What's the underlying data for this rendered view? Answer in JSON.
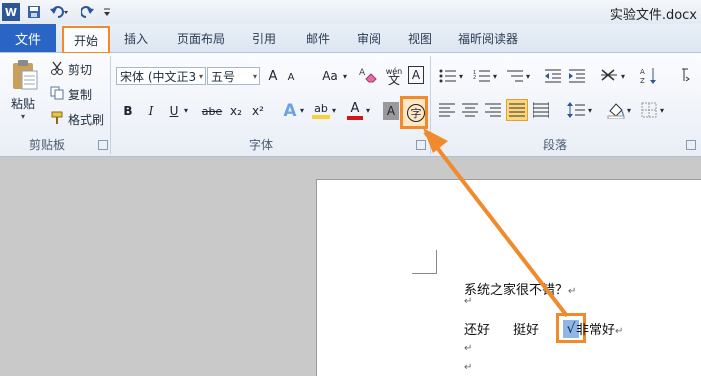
{
  "title_bar": {
    "document_title": "实验文件.docx",
    "quick_access": [
      "word-icon",
      "save-icon",
      "undo-icon",
      "redo-icon",
      "customize-icon"
    ]
  },
  "tabs": {
    "file": "文件",
    "items": [
      "开始",
      "插入",
      "页面布局",
      "引用",
      "邮件",
      "审阅",
      "视图",
      "福昕阅读器"
    ]
  },
  "clipboard": {
    "paste": "粘贴",
    "cut": "剪切",
    "copy": "复制",
    "format_painter": "格式刷",
    "group_label": "剪贴板"
  },
  "font": {
    "font_name": "宋体 (中文正3",
    "font_size": "五号",
    "grow": "A",
    "shrink": "A",
    "change_case": "Aa",
    "phonetic": "wén",
    "char_border": "A",
    "bold": "B",
    "italic": "I",
    "underline": "U",
    "strike": "abe",
    "subscript": "x₂",
    "superscript": "x²",
    "effects": "A",
    "highlight": "ab",
    "font_color": "A",
    "char_shading": "A",
    "enclose_char": "字",
    "group_label": "字体"
  },
  "paragraph": {
    "group_label": "段落"
  },
  "document": {
    "line1": "系统之家很不错？",
    "line2_a": "还好",
    "line2_b": "挺好",
    "line2_check": "√",
    "line2_c": "非常好",
    "para_mark": "↵"
  },
  "colors": {
    "accent_orange": "#f08a2c",
    "file_tab_blue": "#2a64c5",
    "highlight_yellow": "#f2d33a",
    "font_red": "#d01616"
  }
}
